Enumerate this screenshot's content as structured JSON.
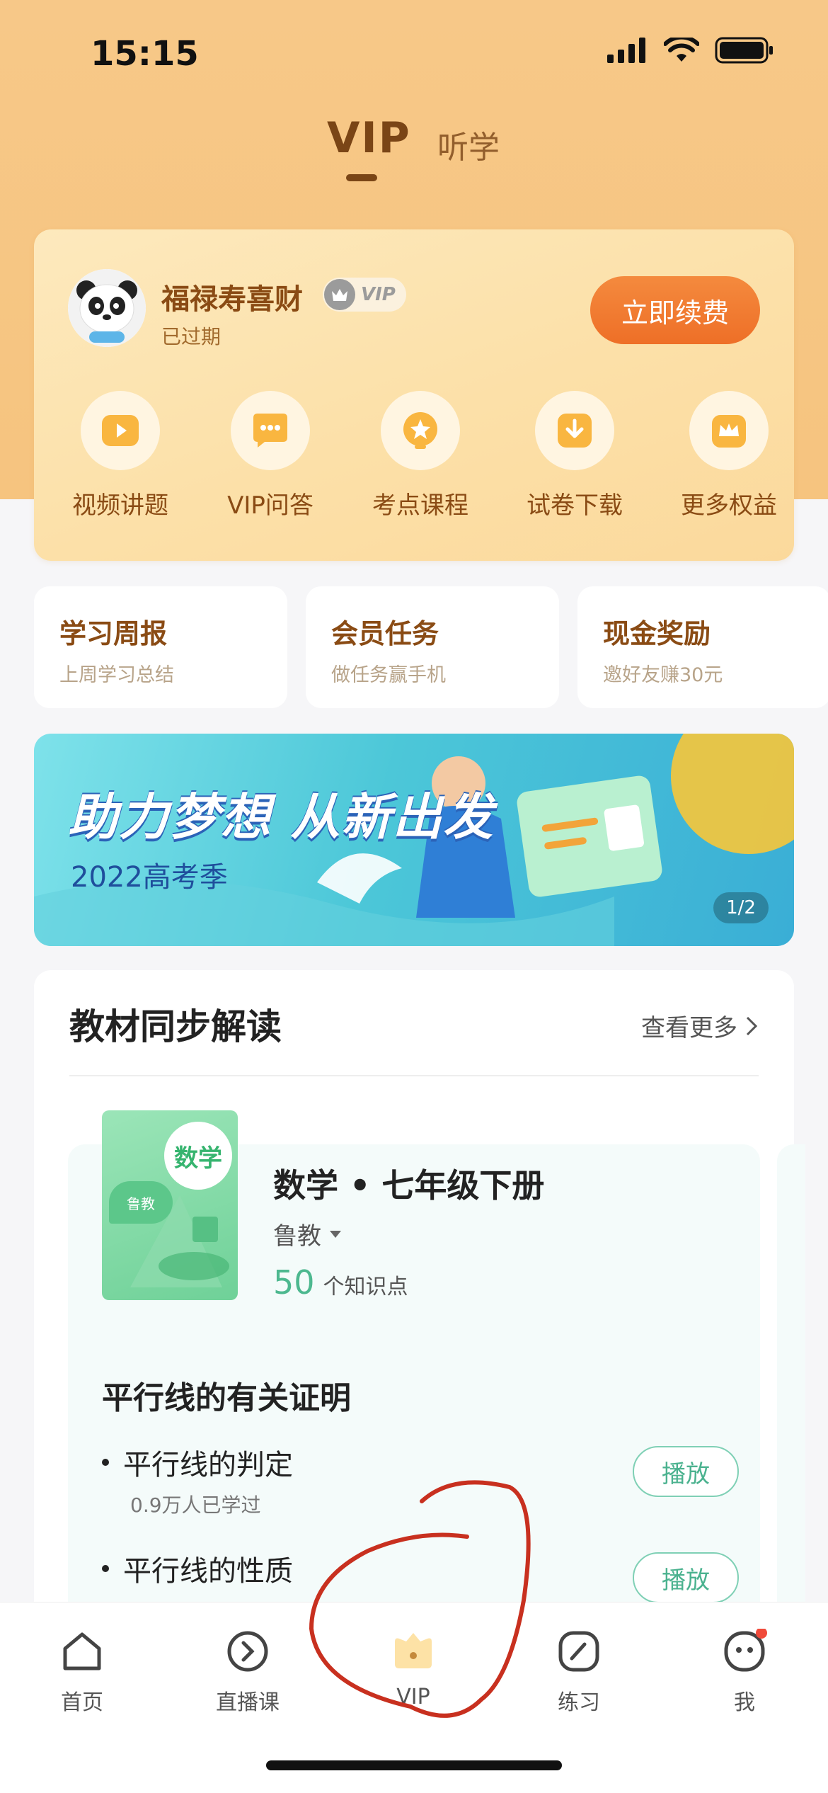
{
  "status_bar": {
    "time": "15:15"
  },
  "top_tabs": [
    {
      "label": "VIP"
    },
    {
      "label": "听学"
    }
  ],
  "vip_card": {
    "user_name": "福禄寿喜财",
    "vip_badge": "VIP",
    "status": "已过期",
    "renew_button": "立即续费",
    "benefits": [
      {
        "label": "视频讲题",
        "icon": "video-icon"
      },
      {
        "label": "VIP问答",
        "icon": "chat-icon"
      },
      {
        "label": "考点课程",
        "icon": "star-icon"
      },
      {
        "label": "试卷下载",
        "icon": "download-icon"
      },
      {
        "label": "更多权益",
        "icon": "crown-icon"
      }
    ]
  },
  "quick_cards": [
    {
      "title": "学习周报",
      "subtitle": "上周学习总结"
    },
    {
      "title": "会员任务",
      "subtitle": "做任务赢手机"
    },
    {
      "title": "现金奖励",
      "subtitle": "邀好友赚30元"
    }
  ],
  "banner": {
    "title": "助力梦想 从新出发",
    "subtitle": "2022高考季",
    "pager": "1/2"
  },
  "textbook": {
    "section_title": "教材同步解读",
    "more": "查看更多",
    "cover_subject": "数学",
    "cover_tag": "鲁教",
    "book_title": "数学 • 七年级下册",
    "publisher": "鲁教",
    "knowledge_count": "50",
    "knowledge_unit": "个知识点",
    "chapter": "平行线的有关证明",
    "lessons": [
      {
        "title": "平行线的判定",
        "learners": "0.9万人已学过",
        "action": "播放"
      },
      {
        "title": "平行线的性质",
        "learners": "",
        "action": "播放"
      }
    ]
  },
  "bottom_nav": [
    {
      "label": "首页",
      "icon": "home-icon"
    },
    {
      "label": "直播课",
      "icon": "live-icon"
    },
    {
      "label": "VIP",
      "icon": "vip-crown-icon"
    },
    {
      "label": "练习",
      "icon": "practice-icon"
    },
    {
      "label": "我",
      "icon": "profile-icon"
    }
  ],
  "colors": {
    "accent": "#ee6f27",
    "brand_brown": "#8a4b14",
    "teal": "#4bb28f",
    "annotation": "#c8301f"
  }
}
